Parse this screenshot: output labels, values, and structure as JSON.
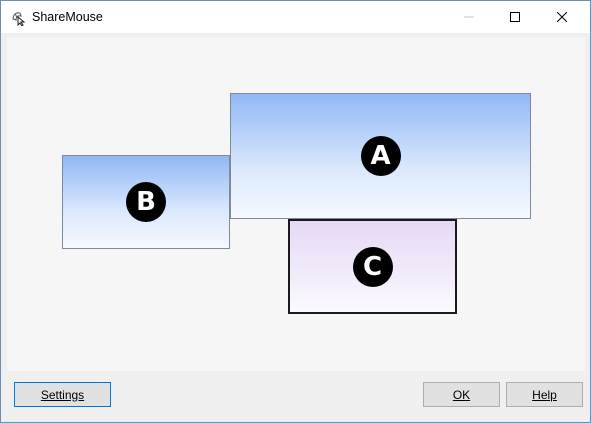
{
  "window": {
    "title": "ShareMouse"
  },
  "title_controls": {
    "minimize_icon": "minimize-icon",
    "maximize_icon": "maximize-icon",
    "close_icon": "close-icon"
  },
  "screens": [
    {
      "id": "A",
      "label": "A"
    },
    {
      "id": "B",
      "label": "B"
    },
    {
      "id": "C",
      "label": "C"
    }
  ],
  "buttons": {
    "settings": "Settings",
    "ok": "OK",
    "help": "Help"
  },
  "colors": {
    "screen_blue_top": "#90b8f6",
    "screen_purple_top": "#e6d9f7",
    "badge_bg": "#000000",
    "focus_border": "#0078d7"
  }
}
